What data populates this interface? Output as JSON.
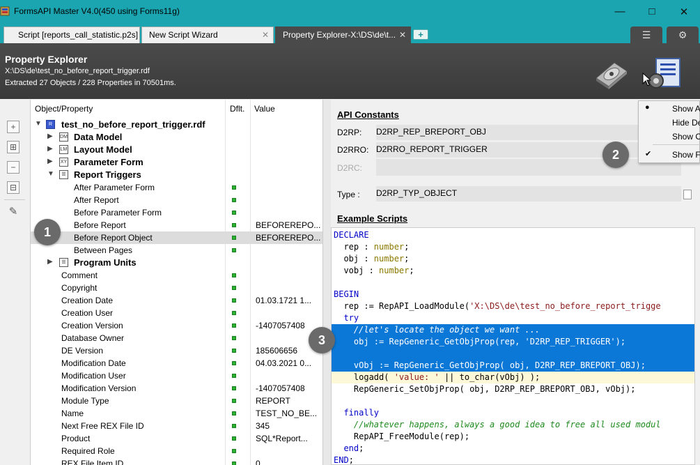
{
  "window": {
    "title": "FormsAPI Master V4.0(450 using Forms11g)",
    "min_icon": "minimize-icon",
    "max_icon": "maximize-icon",
    "close_icon": "close-icon"
  },
  "tabs": [
    {
      "label": "Script [reports_call_statistic.p2s]",
      "active": false
    },
    {
      "label": "New Script Wizard",
      "active": false
    },
    {
      "label": "Property Explorer-X:\\DS\\de\\t...",
      "active": true
    }
  ],
  "header": {
    "title": "Property Explorer",
    "path": "X:\\DS\\de\\test_no_before_report_trigger.rdf",
    "stats": "Extracted 27 Objects / 228 Properties in 70501ms."
  },
  "tree": {
    "columns": [
      "Object/Property",
      "Dflt.",
      "Value"
    ],
    "root": "test_no_before_report_trigger.rdf",
    "rows": [
      {
        "label": "Data Model",
        "value": ""
      },
      {
        "label": "Layout Model",
        "value": ""
      },
      {
        "label": "Parameter Form",
        "value": ""
      },
      {
        "label": "Report Triggers",
        "value": ""
      },
      {
        "label": "After Parameter Form",
        "value": ""
      },
      {
        "label": "After Report",
        "value": ""
      },
      {
        "label": "Before Parameter Form",
        "value": ""
      },
      {
        "label": "Before Report",
        "value": "BEFOREREPO..."
      },
      {
        "label": "Before Report Object",
        "value": "BEFOREREPO..."
      },
      {
        "label": "Between Pages",
        "value": ""
      },
      {
        "label": "Program Units",
        "value": ""
      },
      {
        "label": "Comment",
        "value": ""
      },
      {
        "label": "Copyright",
        "value": ""
      },
      {
        "label": "Creation Date",
        "value": "01.03.1721 1..."
      },
      {
        "label": "Creation User",
        "value": ""
      },
      {
        "label": "Creation Version",
        "value": "-1407057408"
      },
      {
        "label": "Database Owner",
        "value": ""
      },
      {
        "label": "DE Version",
        "value": "185606656"
      },
      {
        "label": "Modification Date",
        "value": "04.03.2021 0..."
      },
      {
        "label": "Modification User",
        "value": ""
      },
      {
        "label": "Modification Version",
        "value": "-1407057408"
      },
      {
        "label": "Module Type",
        "value": "REPORT"
      },
      {
        "label": "Name",
        "value": "TEST_NO_BE..."
      },
      {
        "label": "Next Free REX File ID",
        "value": "345"
      },
      {
        "label": "Product",
        "value": "SQL*Report..."
      },
      {
        "label": "Required Role",
        "value": ""
      },
      {
        "label": "REX File Item ID",
        "value": "0"
      }
    ]
  },
  "api_constants": {
    "title": "API Constants",
    "d2rp_label": "D2RP:",
    "d2rp_value": "D2RP_REP_BREPORT_OBJ",
    "d2rro_label": "D2RRO:",
    "d2rro_value": "D2RRO_REPORT_TRIGGER",
    "d2rc_label": "D2RC:",
    "d2rc_value": "",
    "type_label": "Type :",
    "type_value": "D2RP_TYP_OBJECT"
  },
  "example_scripts": {
    "title": "Example Scripts"
  },
  "context_menu": {
    "items": [
      "Show A",
      "Hide De",
      "Show O",
      "Show Fo"
    ]
  },
  "badges": [
    "1",
    "2",
    "3"
  ]
}
